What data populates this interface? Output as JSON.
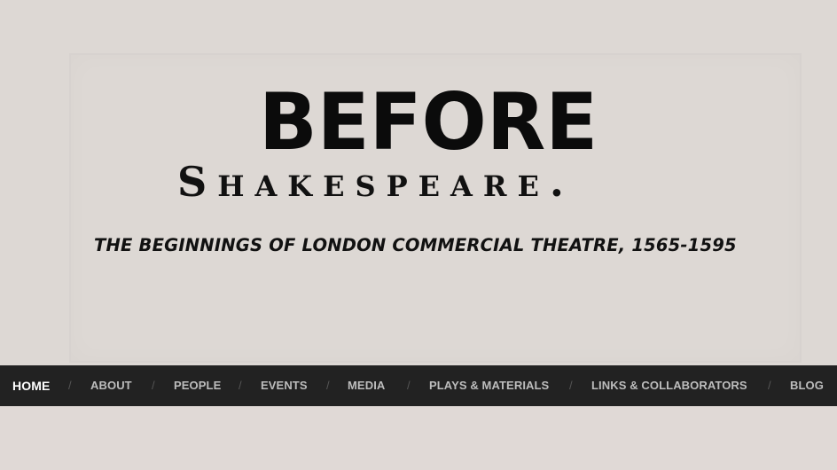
{
  "header": {
    "title_line1": "BEFORE",
    "title_line2": "Shakespeare.",
    "tagline": "THE BEGINNINGS OF LONDON COMMERCIAL THEATRE, 1565-1595"
  },
  "nav": {
    "separator": "/",
    "items": [
      {
        "label": "HOME",
        "active": true
      },
      {
        "label": "ABOUT"
      },
      {
        "label": "PEOPLE"
      },
      {
        "label": "EVENTS"
      },
      {
        "label": "MEDIA"
      },
      {
        "label": "PLAYS & MATERIALS"
      },
      {
        "label": "LINKS & COLLABORATORS"
      },
      {
        "label": "BLOG"
      }
    ]
  },
  "colors": {
    "background": "#e0d9d6",
    "nav_background": "#222222",
    "nav_text": "#bdbdbd",
    "nav_active_text": "#ffffff",
    "title_text": "#0b0b0b"
  }
}
